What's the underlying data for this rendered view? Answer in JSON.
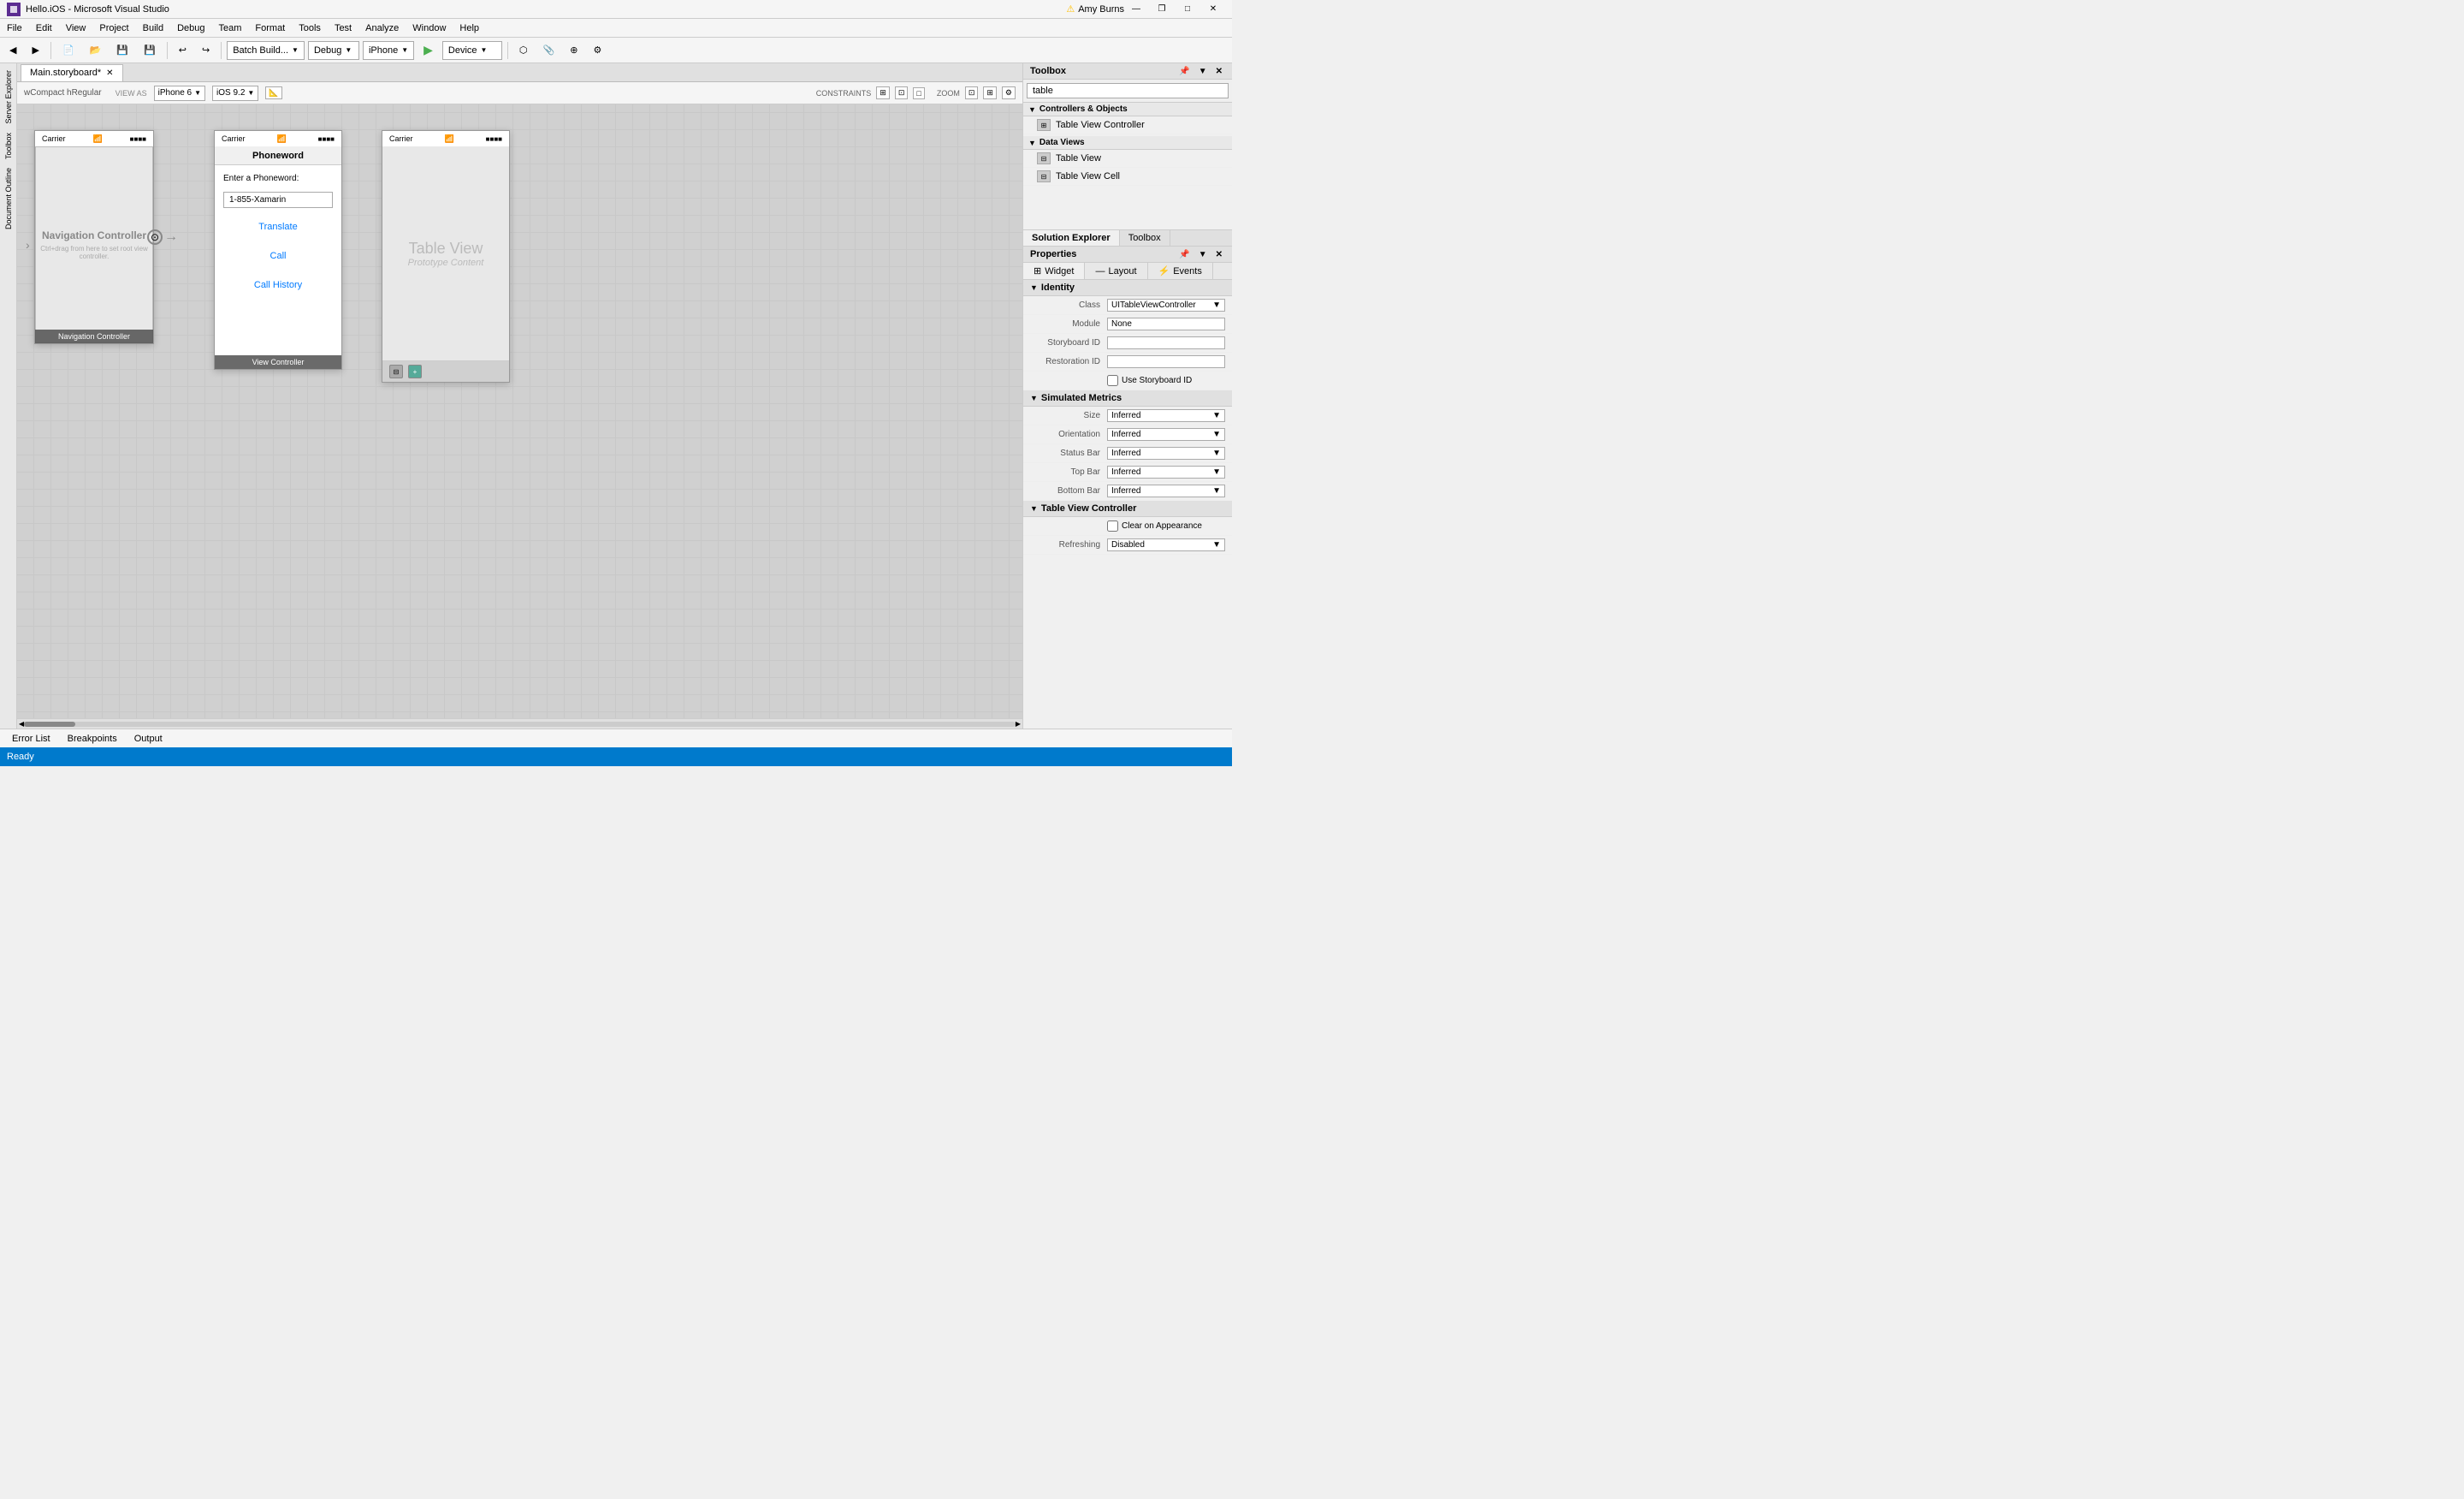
{
  "titleBar": {
    "icon": "VS",
    "title": "Hello.iOS - Microsoft Visual Studio",
    "controls": [
      "minimize",
      "maximize",
      "restore",
      "close"
    ]
  },
  "menuBar": {
    "items": [
      "File",
      "Edit",
      "View",
      "Project",
      "Build",
      "Debug",
      "Team",
      "Format",
      "Tools",
      "Test",
      "Analyze",
      "Window",
      "Help"
    ]
  },
  "toolbar": {
    "buttons": [
      "back",
      "forward"
    ],
    "batchBuild": "Batch Build...",
    "debug": "Debug",
    "device": "iPhone",
    "deviceDropdown": "Device",
    "run": "▶",
    "deviceLabel": "Device"
  },
  "userInfo": {
    "name": "Amy Burns",
    "warningIcon": "⚠"
  },
  "tabs": {
    "items": [
      {
        "label": "Main.storyboard*",
        "active": true
      }
    ]
  },
  "storyboardToolbar": {
    "viewAs": "VIEW AS",
    "iphone": "iPhone 6",
    "ios": "iOS 9.2",
    "constraints": "CONSTRAINTS",
    "zoom": "ZOOM",
    "icons": [
      "fit",
      "expand",
      "settings"
    ]
  },
  "canvas": {
    "screens": [
      {
        "type": "navigation-controller",
        "carrier": "Carrier",
        "wifi": true,
        "battery": "■■■■",
        "title": "Navigation Controller",
        "hint": "Ctrl+drag from here to set root view controller.",
        "label": "Navigation Controller"
      },
      {
        "type": "view-controller",
        "carrier": "Carrier",
        "wifi": true,
        "battery": "■■■■",
        "navTitle": "Phoneword",
        "phonewordLabel": "Enter a Phoneword:",
        "phonewordInput": "1-855-Xamarin",
        "buttons": [
          "Translate",
          "Call",
          "Call History"
        ],
        "label": "View Controller"
      },
      {
        "type": "table-view",
        "carrier": "Carrier",
        "wifi": true,
        "battery": "■■■■",
        "tableTitle": "Table View",
        "tableSub": "Prototype Content"
      }
    ]
  },
  "toolbox": {
    "title": "Toolbox",
    "searchPlaceholder": "table",
    "sections": [
      {
        "title": "Controllers & Objects",
        "items": [
          {
            "label": "Table View Controller",
            "icon": "⊞"
          },
          {
            "label": "Table View",
            "icon": "⊟"
          },
          {
            "label": "Table View Cell",
            "icon": "⊟"
          }
        ]
      }
    ]
  },
  "panelTabs": {
    "items": [
      "Solution Explorer",
      "Toolbox"
    ]
  },
  "properties": {
    "title": "Properties",
    "tabs": [
      {
        "label": "Widget",
        "icon": "⊞",
        "active": true
      },
      {
        "label": "Layout",
        "icon": "⊡"
      },
      {
        "label": "Events",
        "icon": "⚡"
      }
    ],
    "sections": {
      "identity": {
        "title": "Identity",
        "fields": [
          {
            "label": "Class",
            "type": "dropdown",
            "value": "UITableViewController"
          },
          {
            "label": "Module",
            "type": "input",
            "value": "None"
          },
          {
            "label": "Storyboard ID",
            "type": "input",
            "value": ""
          },
          {
            "label": "Restoration ID",
            "type": "input",
            "value": ""
          },
          {
            "label": "",
            "type": "checkbox",
            "value": "Use Storyboard ID"
          }
        ]
      },
      "simulatedMetrics": {
        "title": "Simulated Metrics",
        "fields": [
          {
            "label": "Size",
            "type": "dropdown",
            "value": "Inferred"
          },
          {
            "label": "Orientation",
            "type": "dropdown",
            "value": "Inferred"
          },
          {
            "label": "Status Bar",
            "type": "dropdown",
            "value": "Inferred"
          },
          {
            "label": "Top Bar",
            "type": "dropdown",
            "value": "Inferred"
          },
          {
            "label": "Bottom Bar",
            "type": "dropdown",
            "value": "Inferred"
          }
        ]
      },
      "tableViewController": {
        "title": "Table View Controller",
        "fields": [
          {
            "label": "",
            "type": "checkbox",
            "value": "Clear on Appearance"
          },
          {
            "label": "Refreshing",
            "type": "dropdown",
            "value": "Disabled"
          }
        ]
      }
    }
  },
  "bottomTabs": {
    "items": [
      "Error List",
      "Breakpoints",
      "Output"
    ]
  },
  "statusBar": {
    "text": "Ready"
  }
}
